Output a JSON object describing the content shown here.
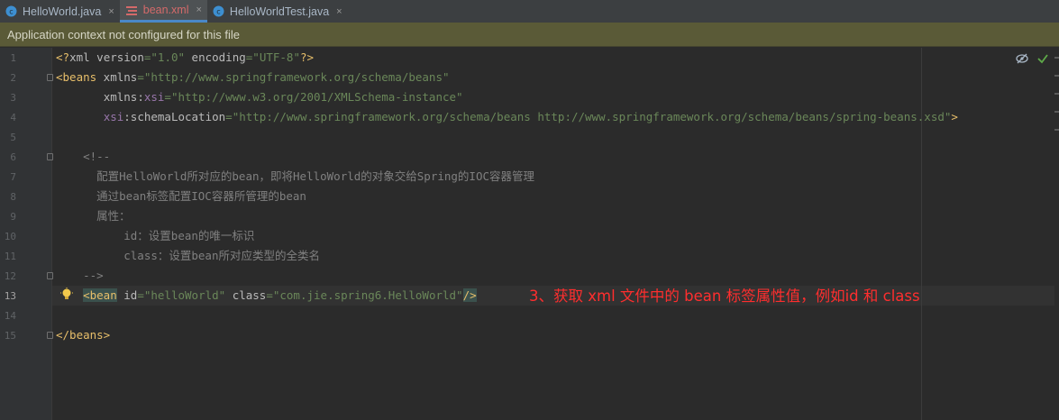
{
  "tabs": [
    {
      "label": "HelloWorld.java",
      "icon": "java-class-icon",
      "active": false
    },
    {
      "label": "bean.xml",
      "icon": "xml-file-icon",
      "active": true
    },
    {
      "label": "HelloWorldTest.java",
      "icon": "java-class-icon",
      "active": false
    }
  ],
  "tab_close_glyph": "×",
  "banner": "Application context not configured for this file",
  "line_numbers": [
    "1",
    "2",
    "3",
    "4",
    "5",
    "6",
    "7",
    "8",
    "9",
    "10",
    "11",
    "12",
    "13",
    "14",
    "15"
  ],
  "current_line": "13",
  "code": {
    "l1": {
      "open": "<?",
      "name": "xml",
      "a1": " version",
      "eq1": "=",
      "v1": "\"1.0\"",
      "a2": " encoding",
      "eq2": "=",
      "v2": "\"UTF-8\"",
      "close": "?>"
    },
    "l2": {
      "open": "<beans",
      "a1": " xmlns",
      "eq1": "=",
      "v1": "\"http://www.springframework.org/schema/beans\""
    },
    "l3": {
      "indent": "       ",
      "a1": "xmlns:",
      "ns": "xsi",
      "eq1": "=",
      "v1": "\"http://www.w3.org/2001/XMLSchema-instance\""
    },
    "l4": {
      "indent": "       ",
      "ns": "xsi",
      "a1": ":schemaLocation",
      "eq1": "=",
      "v1": "\"http://www.springframework.org/schema/beans http://www.springframework.org/schema/beans/spring-beans.xsd\"",
      "close": ">"
    },
    "l6": "    <!--",
    "l7": "      配置HelloWorld所对应的bean，即将HelloWorld的对象交给Spring的IOC容器管理",
    "l8": "      通过bean标签配置IOC容器所管理的bean",
    "l9": "      属性：",
    "l10": "          id：设置bean的唯一标识",
    "l11": "          class：设置bean所对应类型的全类名",
    "l12": "    -->",
    "l13": {
      "indent": "    ",
      "open": "<bean",
      "a1": " id",
      "eq1": "=",
      "v1": "\"helloWorld\"",
      "a2": " class",
      "eq2": "=",
      "v2": "\"com.jie.spring6.HelloWorld\"",
      "close": "/>"
    },
    "l15": "</beans>"
  },
  "annotation": "3、获取 xml 文件中的 bean 标签属性值，例如id 和 class",
  "colors": {
    "annotation": "#ff2e2e",
    "tag": "#e8bf6a",
    "value": "#6a8759",
    "comment": "#808080",
    "namespace": "#9876aa"
  }
}
